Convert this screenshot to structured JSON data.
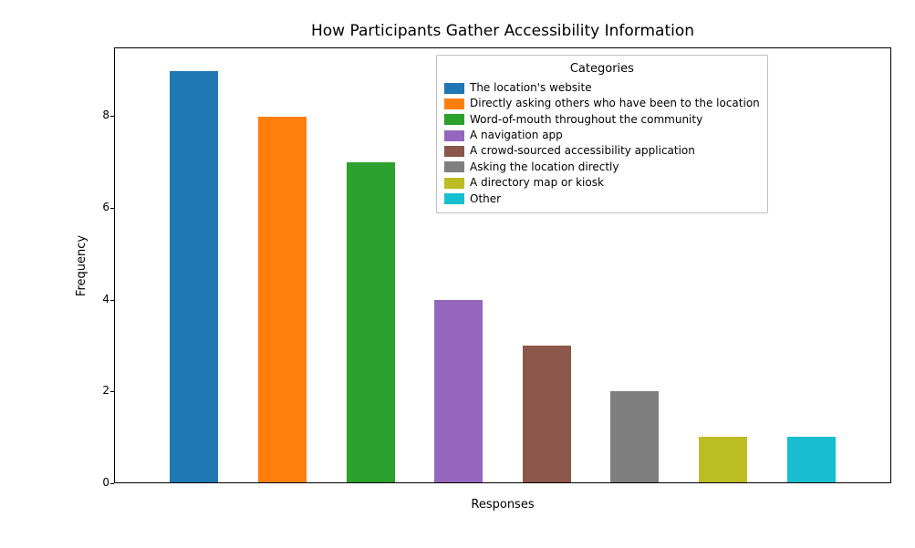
{
  "chart_data": {
    "type": "bar",
    "title": "How Participants Gather Accessibility Information",
    "xlabel": "Responses",
    "ylabel": "Frequency",
    "ylim": [
      0,
      9.5
    ],
    "yticks": [
      0,
      2,
      4,
      6,
      8
    ],
    "categories": [
      "The location's website",
      "Directly asking others who have been to the location",
      "Word-of-mouth throughout the community",
      "A navigation app",
      "A crowd-sourced accessibility application",
      "Asking the location directly",
      "A directory map or kiosk",
      "Other"
    ],
    "values": [
      9,
      8,
      7,
      4,
      3,
      2,
      1,
      1
    ],
    "colors": [
      "#1f77b4",
      "#ff7f0e",
      "#2ca02c",
      "#9467bd",
      "#8c564b",
      "#7f7f7f",
      "#bcbd22",
      "#17becf"
    ],
    "legend_title": "Categories",
    "legend_position": "upper-right-inside"
  }
}
